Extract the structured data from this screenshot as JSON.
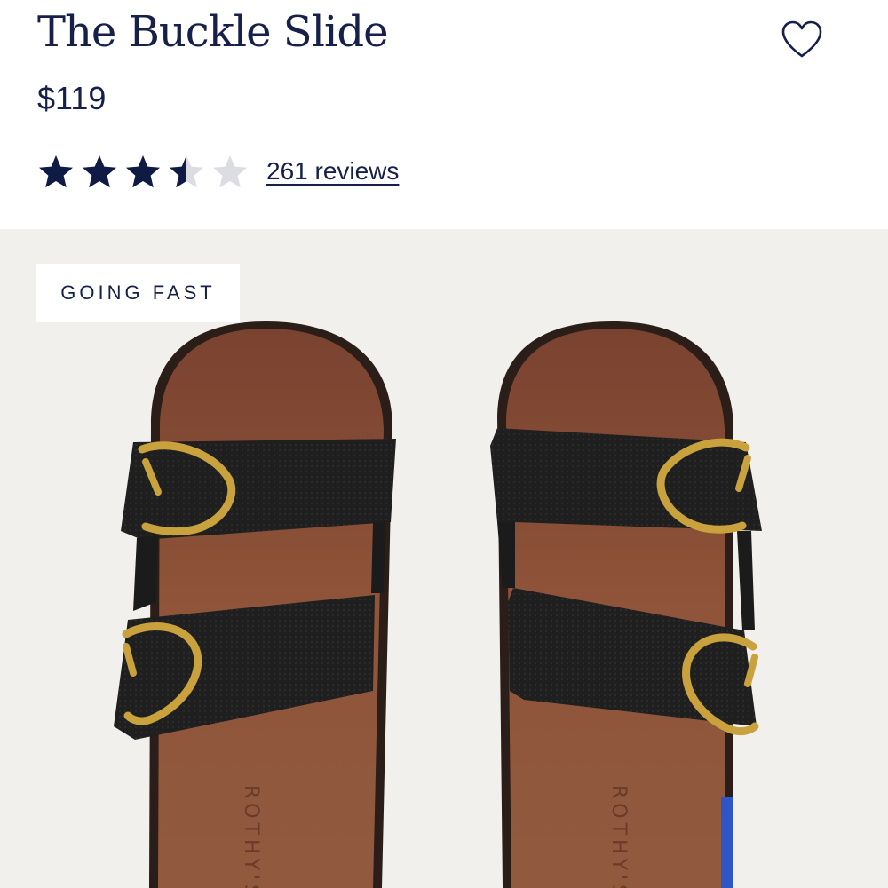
{
  "product": {
    "title": "The Buckle Slide",
    "price": "$119",
    "rating": 3.5,
    "rating_max": 5,
    "reviews_label": "261 reviews",
    "favorite_icon": "heart-outline-icon"
  },
  "hero": {
    "badge": "GOING FAST",
    "insole_brand": "ROTHY'S"
  },
  "colors": {
    "navy": "#16204a",
    "star_filled": "#0f1a45",
    "star_empty": "#dcdde2",
    "hero_bg": "#f1f0ed",
    "footbed": "#8a4f37",
    "strap": "#1e1e1e",
    "buckle": "#c9a23e"
  }
}
